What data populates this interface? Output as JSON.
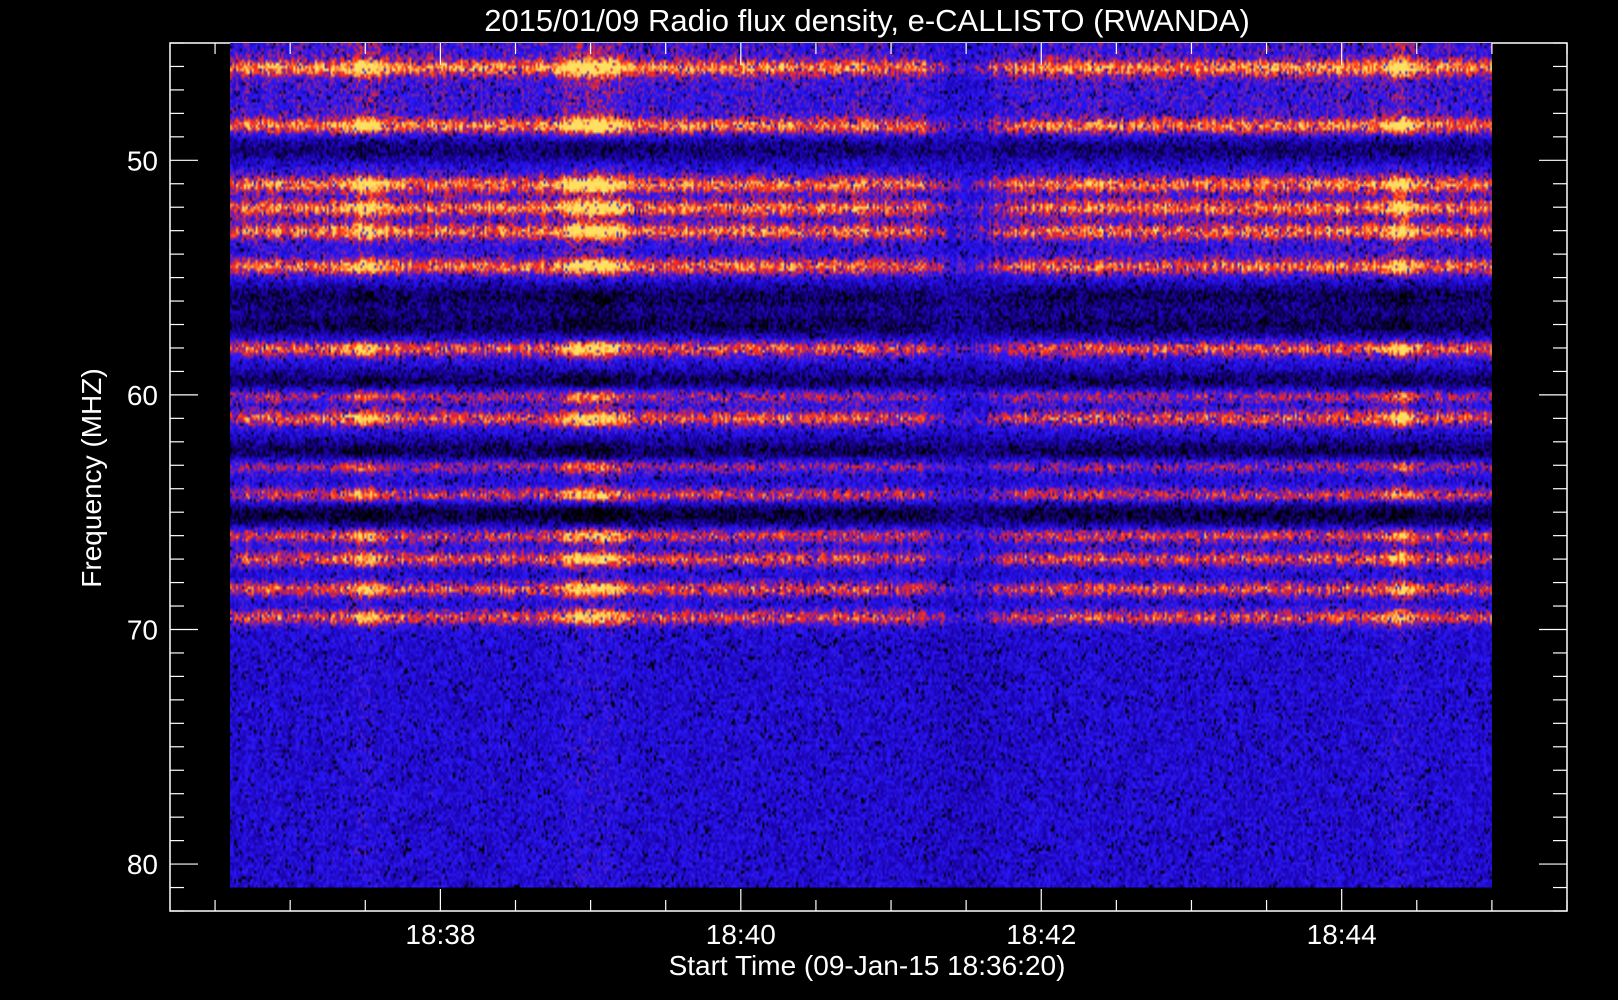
{
  "chart_data": {
    "type": "heatmap",
    "title": "2015/01/09  Radio flux density, e-CALLISTO (RWANDA)",
    "xlabel": "Start Time (09-Jan-15 18:36:20)",
    "ylabel": "Frequency (MHZ)",
    "x_ticks": [
      "18:38",
      "18:40",
      "18:42",
      "18:44"
    ],
    "x_tick_minutes": [
      38,
      40,
      42,
      44
    ],
    "xlim_minutes": [
      36.2,
      45.5
    ],
    "data_x_range_minutes": [
      36.6,
      45.0
    ],
    "y_ticks": [
      50,
      60,
      70,
      80
    ],
    "ylim": [
      45,
      82
    ],
    "data_y_range": [
      45,
      81
    ],
    "y_inverted": true,
    "colormap": [
      "#000000",
      "#1a00a0",
      "#2a1aff",
      "#ff2a10",
      "#ffe060"
    ],
    "bright_bands_mhz": [
      46,
      48.5,
      51,
      52,
      53,
      54.5,
      58,
      60,
      61,
      63,
      64.3,
      66,
      67,
      68.3,
      69.5
    ],
    "quiet_bands_mhz": [
      49.5,
      55.8,
      57,
      59.5,
      62.5,
      65.1
    ],
    "enhanced_time_minutes": [
      37.5,
      38.9,
      39.1,
      44.4
    ],
    "quiet_time_minutes": [
      41.4,
      41.6
    ]
  }
}
